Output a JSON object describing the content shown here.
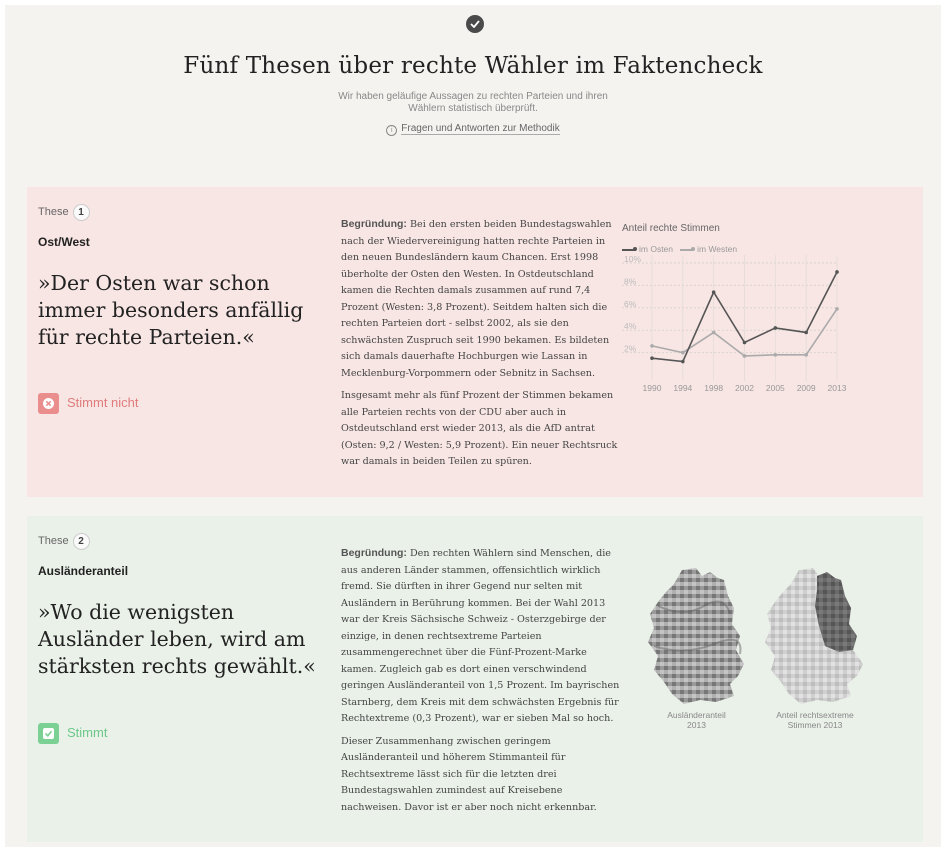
{
  "header": {
    "title": "Fünf Thesen über rechte Wähler im Faktencheck",
    "subtitle": "Wir haben geläufige Aussagen zu rechten Parteien und ihren Wählern statistisch überprüft.",
    "method_link": "Fragen und Antworten zur Methodik",
    "icons": {
      "badge": "check-circle-icon",
      "info": "info-icon"
    }
  },
  "theses": [
    {
      "label": "These",
      "number": "1",
      "topic": "Ost/West",
      "quote": "»Der Osten war schon immer besonders anfällig für rechte Parteien.«",
      "verdict": "Stimmt nicht",
      "verdict_icon": "close-icon",
      "background": "#f8e6e4",
      "verdict_color": "#e07b7b",
      "reason_lead": "Begründung:",
      "reason": "Bei den ersten beiden Bundestagswahlen nach der Wiedervereinigung hatten rechte Parteien in den neuen Bundesländern kaum Chancen. Erst 1998 überholte der Osten den Westen. In Ostdeutschland kamen die Rechten damals zusammen auf rund 7,4 Prozent (Westen: 3,8 Prozent). Seitdem halten sich die rechten Parteien dort - selbst 2002, als sie den schwächsten Zuspruch seit 1990 bekamen. Es bildeten sich damals dauerhafte Hochburgen wie Lassan in Mecklenburg-Vorpommern oder Sebnitz in Sachsen.",
      "reason2": "Insgesamt mehr als fünf Prozent der Stimmen bekamen alle Parteien rechts von der CDU aber auch in Ostdeutschland erst wieder 2013, als die AfD antrat (Osten: 9,2 / Westen: 5,9 Prozent). Ein neuer Rechtsruck war damals in beiden Teilen zu spüren."
    },
    {
      "label": "These",
      "number": "2",
      "topic": "Ausländeranteil",
      "quote": "»Wo die wenigsten Ausländer leben, wird am stärksten rechts gewählt.«",
      "verdict": "Stimmt",
      "verdict_icon": "check-icon",
      "background": "#eaf1e9",
      "verdict_color": "#6cc98a",
      "reason_lead": "Begründung:",
      "reason": "Den rechten Wählern sind Menschen, die aus anderen Länder stammen, offensichtlich wirklich fremd. Sie dürften in ihrer Gegend nur selten mit Ausländern in Berührung kommen. Bei der Wahl 2013 war der Kreis Sächsische Schweiz - Osterzgebirge der einzige, in denen rechtsextreme Parteien zusammengerechnet über die Fünf-Prozent-Marke kamen. Zugleich gab es dort einen verschwindend geringen Ausländeranteil von 1,5 Prozent. Im bayrischen Starnberg, dem Kreis mit dem schwächsten Ergebnis für Rechtextreme (0,3 Prozent), war er sieben Mal so hoch.",
      "reason2": "Dieser Zusammenhang zwischen geringem Ausländeranteil und höherem Stimmanteil für Rechtsextreme lässt sich für die letzten drei Bundestagswahlen zumindest auf Kreisebene nachweisen. Davor ist er aber noch nicht erkennbar.",
      "maps": [
        {
          "caption_line1": "Ausländeranteil",
          "caption_line2": "2013",
          "icon": "germany-map-icon"
        },
        {
          "caption_line1": "Anteil rechtsextreme",
          "caption_line2": "Stimmen 2013",
          "icon": "germany-map-icon"
        }
      ]
    }
  ],
  "chart_data": {
    "type": "line",
    "title": "Anteil rechte Stimmen",
    "x": [
      "1990",
      "1994",
      "1998",
      "2002",
      "2005",
      "2009",
      "2013"
    ],
    "series": [
      {
        "name": "im Osten",
        "values": [
          1.5,
          1.2,
          7.4,
          2.9,
          4.2,
          3.8,
          9.2
        ],
        "color": "#555555"
      },
      {
        "name": "im Westen",
        "values": [
          2.6,
          2.0,
          3.8,
          1.7,
          1.8,
          1.8,
          5.9
        ],
        "color": "#aaaaaa"
      }
    ],
    "yticks": [
      "2%",
      "4%",
      "6%",
      "8%",
      "10%"
    ],
    "ylim": [
      0,
      10
    ],
    "grid": true,
    "legend_position": "top-left"
  }
}
